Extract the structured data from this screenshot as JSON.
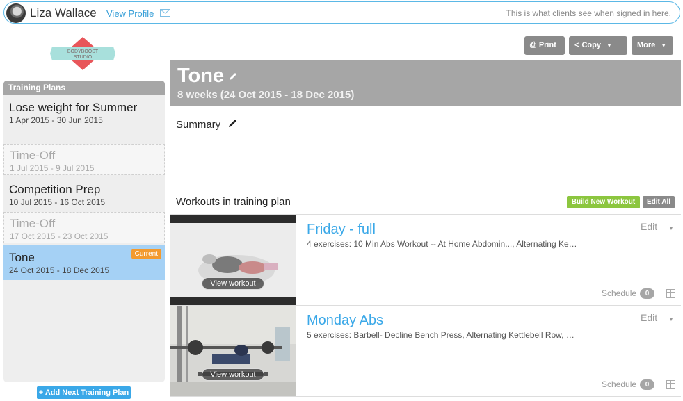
{
  "header": {
    "user_name": "Liza Wallace",
    "view_profile": "View Profile",
    "client_note": "This is what clients see when signed in here."
  },
  "logo": {
    "line1": "BODYBOOST",
    "line2": "STUDIO"
  },
  "sidebar": {
    "title": "Training Plans",
    "plans": [
      {
        "name": "Lose weight for Summer",
        "dates": "1 Apr 2015 - 30 Jun 2015",
        "style": "normal"
      },
      {
        "name": "Time-Off",
        "dates": "1 Jul 2015 - 9 Jul 2015",
        "style": "off"
      },
      {
        "name": "Competition Prep",
        "dates": "10 Jul 2015 - 16 Oct 2015",
        "style": "normal"
      },
      {
        "name": "Time-Off",
        "dates": "17 Oct 2015 - 23 Oct 2015",
        "style": "off"
      },
      {
        "name": "Tone",
        "dates": "24 Oct 2015 - 18 Dec 2015",
        "style": "active",
        "badge": "Current"
      }
    ],
    "add_button": "+ Add Next Training Plan"
  },
  "toolbar": {
    "print": "Print",
    "copy": "Copy",
    "more": "More"
  },
  "plan": {
    "title": "Tone",
    "duration": "8 weeks (24 Oct 2015 - 18 Dec 2015)",
    "summary_label": "Summary"
  },
  "workouts_section": {
    "label": "Workouts in training plan",
    "build_button": "Build New Workout",
    "edit_all_button": "Edit All"
  },
  "workouts": [
    {
      "title": "Friday - full",
      "description": "4 exercises: 10 Min Abs Workout -- At Home Abdomin..., Alternating Ke…",
      "view_label": "View workout",
      "edit_label": "Edit",
      "schedule_label": "Schedule",
      "schedule_count": "0"
    },
    {
      "title": "Monday Abs",
      "description": "5 exercises: Barbell- Decline Bench Press, Alternating Kettlebell Row, …",
      "view_label": "View workout",
      "edit_label": "Edit",
      "schedule_label": "Schedule",
      "schedule_count": "0"
    }
  ],
  "colors": {
    "accent_blue": "#3aa8e8",
    "header_gray": "#a6a6a6",
    "active_plan": "#a5d1f5",
    "badge_orange": "#f39a2e",
    "build_green": "#8cc63f"
  }
}
